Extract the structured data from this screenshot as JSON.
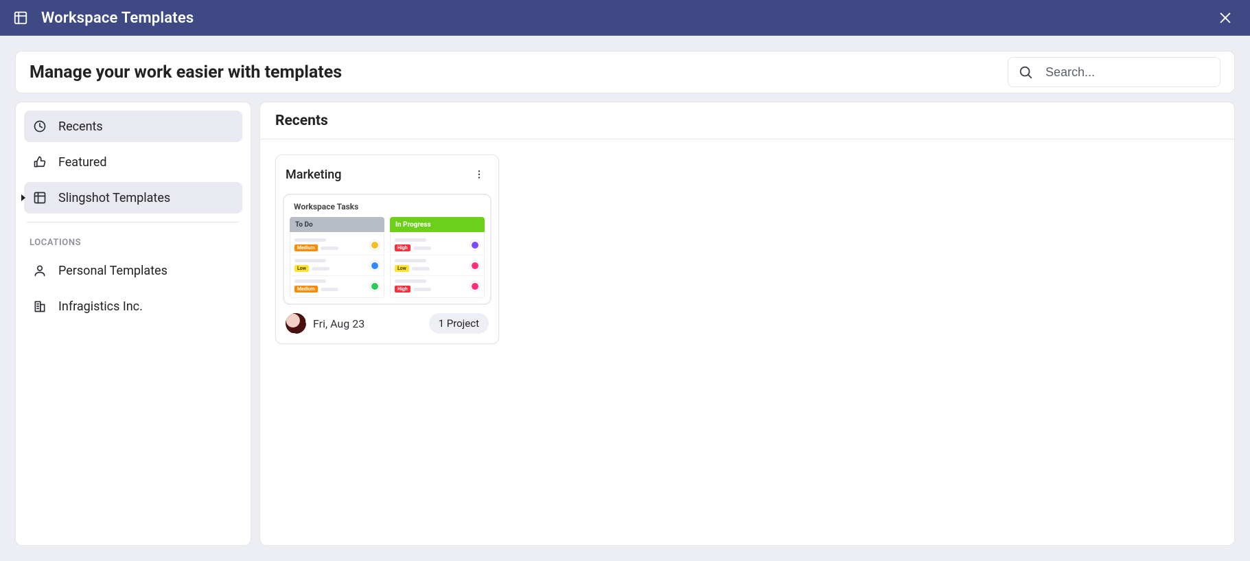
{
  "titlebar": {
    "title": "Workspace Templates"
  },
  "hero": {
    "heading": "Manage your work easier with templates"
  },
  "search": {
    "placeholder": "Search..."
  },
  "sidebar": {
    "items": [
      {
        "label": "Recents"
      },
      {
        "label": "Featured"
      },
      {
        "label": "Slingshot Templates"
      }
    ],
    "locations_heading": "LOCATIONS",
    "locations": [
      {
        "label": "Personal Templates"
      },
      {
        "label": "Infragistics Inc."
      }
    ]
  },
  "section": {
    "title": "Recents"
  },
  "card": {
    "title": "Marketing",
    "preview_title": "Workspace Tasks",
    "columns": {
      "todo": {
        "header": "To Do",
        "tasks": [
          "Medium",
          "Low",
          "Medium"
        ]
      },
      "progress": {
        "header": "In Progress",
        "tasks": [
          "High",
          "Low",
          "High"
        ]
      }
    },
    "date": "Fri, Aug 23",
    "chip": "1 Project"
  }
}
